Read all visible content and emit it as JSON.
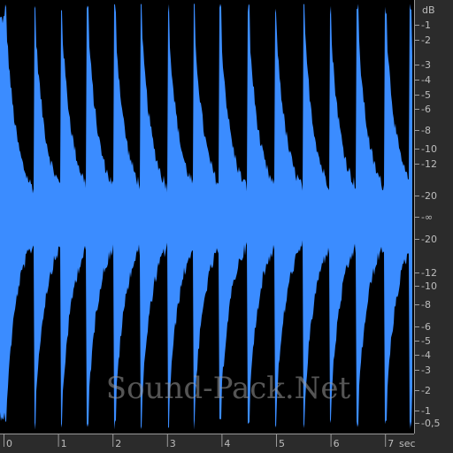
{
  "colors": {
    "background": "#000000",
    "waveform": "#3b8cff",
    "panel": "#2b2b2b",
    "ruler_text": "#bdbdbd",
    "ruler_line": "#9a9a9a",
    "watermark": "#9a9a9a"
  },
  "db_scale": {
    "unit": "dB",
    "upper_ticks": [
      "-1",
      "-2",
      "-3",
      "-4",
      "-5",
      "-6",
      "-8",
      "-10",
      "-12",
      "-20"
    ],
    "center": "-∞",
    "lower_ticks": [
      "-20",
      "-12",
      "-10",
      "-8",
      "-6",
      "-5",
      "-4",
      "-3",
      "-2",
      "-1",
      "-0,5"
    ]
  },
  "time_scale": {
    "unit": "sec",
    "ticks": [
      "0",
      "1",
      "2",
      "3",
      "4",
      "5",
      "6",
      "7"
    ]
  },
  "waveform": {
    "duration_sec": 7.45,
    "hit_times_sec": [
      0.0,
      0.53,
      1.02,
      1.5,
      2.0,
      2.48,
      2.98,
      3.45,
      3.93,
      4.45,
      4.95,
      5.47,
      5.95,
      6.45,
      6.97,
      7.42
    ]
  },
  "watermark": "Sound-Pack.Net"
}
